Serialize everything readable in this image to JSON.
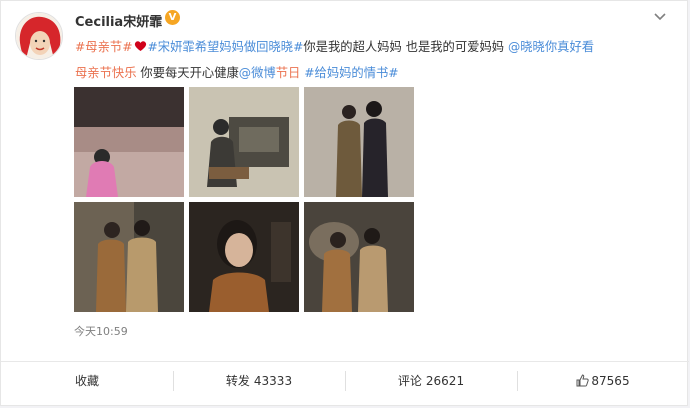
{
  "post": {
    "username": "Cecilia宋妍霏",
    "verified_badge": "V",
    "text_segments": [
      {
        "text": "#母亲节#",
        "kind": "tag"
      },
      {
        "text": "heart-emoji",
        "kind": "icon"
      },
      {
        "text": "#宋妍霏希望妈妈做回晓晓#",
        "kind": "link"
      },
      {
        "text": "你是我的超人妈妈 也是我的可爱妈妈 ",
        "kind": "plain"
      },
      {
        "text": "@晓晓你真好看",
        "kind": "link"
      },
      {
        "text": "母亲节快乐",
        "kind": "tag"
      },
      {
        "text": " 你要每天开心健康",
        "kind": "plain"
      },
      {
        "text": "@微博节日",
        "kind": "mixed"
      },
      {
        "text": " ",
        "kind": "plain"
      },
      {
        "text": "#给妈妈的情书#",
        "kind": "link"
      }
    ],
    "line1": {
      "tag1": "#母亲节#",
      "tag2": "#宋妍霏希望妈妈做回晓晓#",
      "plain1": "你是我的超人妈妈 也是我的可爱妈妈 ",
      "mention1": "@晓晓你真好看"
    },
    "line2": {
      "tag3": "母亲节快乐",
      "plain2": " 你要每天开心健康",
      "mention2_part1": "@微博",
      "mention2_part2": "节日",
      "tag4": " #给妈妈的情书#"
    },
    "photos": [
      {
        "alt": "stage-photo"
      },
      {
        "alt": "studio-photo"
      },
      {
        "alt": "duo-photo-1"
      },
      {
        "alt": "duo-photo-2"
      },
      {
        "alt": "portrait-photo"
      },
      {
        "alt": "duo-photo-3"
      }
    ],
    "timestamp": "今天10:59"
  },
  "actions": {
    "favorite": {
      "label": "收藏"
    },
    "repost": {
      "label": "转发",
      "count": "43333"
    },
    "comment": {
      "label": "评论",
      "count": "26621"
    },
    "like": {
      "count": "87565"
    }
  },
  "colors": {
    "tag": "#eb7350",
    "link": "#4a8cd8",
    "verified": "#f6a623"
  },
  "icons": [
    "more-chevron-icon",
    "verified-icon",
    "heart-icon",
    "thumbs-up-icon"
  ]
}
